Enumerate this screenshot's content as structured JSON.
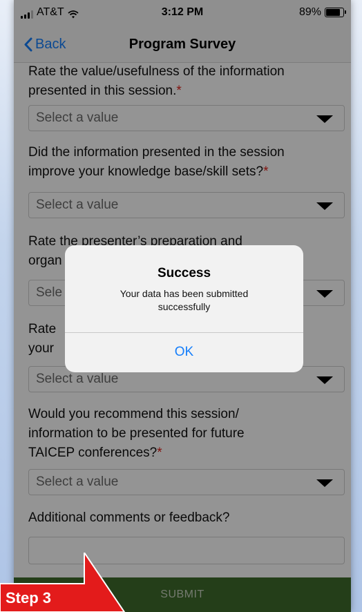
{
  "status_bar": {
    "carrier": "AT&T",
    "time": "3:12 PM",
    "battery": "89%",
    "battery_level": 0.89
  },
  "nav": {
    "back_label": "Back",
    "title": "Program Survey"
  },
  "questions": [
    {
      "line1": "Rate the value/usefulness of the information",
      "line2": "presented in this session.",
      "required_mark": "*",
      "select_value": "Select a value"
    },
    {
      "line1": "Did the information presented in the session",
      "line2": "improve your knowledge base/skill sets?",
      "required_mark": "*",
      "select_value": "Select a value"
    },
    {
      "line1": "Rate the presenter’s preparation and",
      "line2": "organ",
      "select_value": "Sele"
    },
    {
      "line1": "Rate",
      "line2": "your",
      "select_value": "Select a value"
    },
    {
      "line1": "Would you recommend this session/",
      "line2": "information to be presented for future",
      "line3": "TAICEP conferences?",
      "required_mark": "*",
      "select_value": "Select a value"
    },
    {
      "line1": "Additional comments or feedback?"
    }
  ],
  "submit_label": "SUBMIT",
  "alert": {
    "title": "Success",
    "message_line1": "Your data has been submitted",
    "message_line2": "successfully",
    "ok_label": "OK"
  },
  "callout": {
    "label": "Step 3",
    "color": "#e31b1b"
  },
  "colors": {
    "ios_blue": "#147efb",
    "required_red": "#e0221b",
    "submit_green": "#3f6b2c"
  }
}
